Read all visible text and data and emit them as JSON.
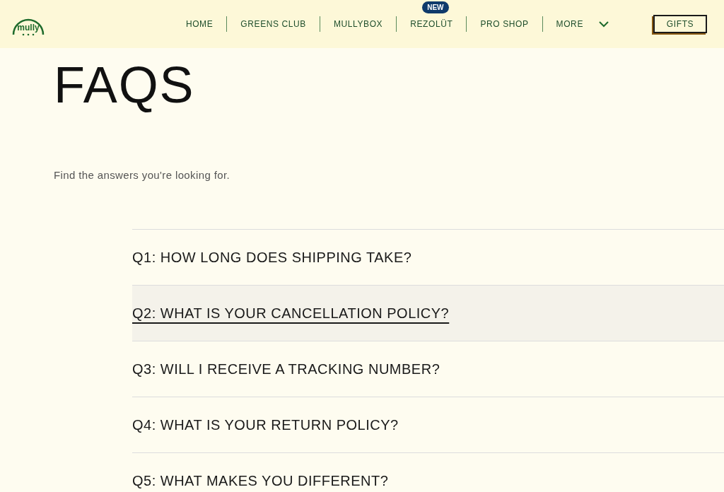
{
  "logo": {
    "text": "mully"
  },
  "nav": [
    {
      "label": "HOME"
    },
    {
      "label": "GREENS CLUB"
    },
    {
      "label": "MULLYBOX"
    },
    {
      "label": "REZOLÜT",
      "badge": "NEW"
    },
    {
      "label": "PRO SHOP"
    },
    {
      "label": "MORE",
      "dropdown": true
    }
  ],
  "gifts_button": "GIFTS",
  "title": "FAQS",
  "subtitle": "Find the answers you're looking for.",
  "faqs": [
    {
      "question": "Q1: HOW LONG DOES SHIPPING TAKE?",
      "selected": false
    },
    {
      "question": "Q2: WHAT IS YOUR CANCELLATION POLICY?",
      "selected": true
    },
    {
      "question": "Q3: WILL I RECEIVE A TRACKING NUMBER?",
      "selected": false
    },
    {
      "question": "Q4: WHAT IS YOUR RETURN POLICY?",
      "selected": false
    },
    {
      "question": "Q5: WHAT MAKES YOU DIFFERENT?",
      "selected": false
    }
  ]
}
